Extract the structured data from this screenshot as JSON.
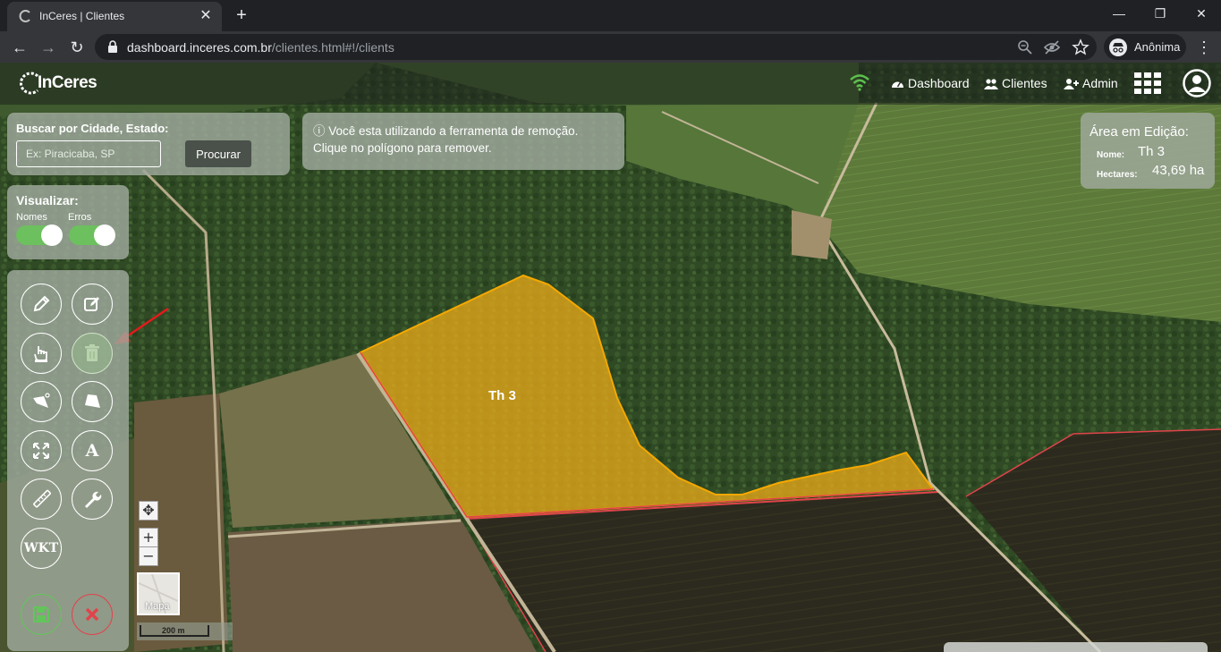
{
  "browser": {
    "tab_title": "InCeres | Clientes",
    "tab_close": "✕",
    "new_tab": "+",
    "window_controls": {
      "minimize": "—",
      "maximize": "❐",
      "close": "✕"
    },
    "nav": {
      "back": "←",
      "forward": "→",
      "reload": "↻"
    },
    "url_host": "dashboard.inceres.com.br",
    "url_path": "/clientes.html#!/clients",
    "profile_label": "Anônima",
    "menu": "⋮"
  },
  "app": {
    "logo_text": "InCeres",
    "nav_links": [
      {
        "label": "Dashboard",
        "icon": "gauge-icon"
      },
      {
        "label": "Clientes",
        "icon": "users-icon"
      },
      {
        "label": "Admin",
        "icon": "user-plus-icon"
      }
    ],
    "colors": {
      "accent_green": "#6cc05d",
      "polygon_fill": "#e6a81a",
      "polygon_stroke": "#f5a800",
      "removal_red": "#e0444b"
    }
  },
  "search": {
    "label": "Buscar por Cidade, Estado:",
    "placeholder": "Ex: Piracicaba, SP",
    "button": "Procurar"
  },
  "info": {
    "line1": "ⓘ Você esta utilizando a ferramenta de remoção.",
    "line2": "Clique no polígono para remover."
  },
  "edit_area": {
    "title": "Área em Edição:",
    "name_label": "Nome:",
    "name_value": "Th 3",
    "hectares_label": "Hectares:",
    "hectares_value": "43,69 ha"
  },
  "view": {
    "title": "Visualizar:",
    "toggles": [
      {
        "label": "Nomes",
        "on": true
      },
      {
        "label": "Erros",
        "on": true
      }
    ]
  },
  "tools": {
    "text_tool": "A",
    "wkt": "WKT",
    "items": [
      "pencil-icon",
      "edit-square-icon",
      "hand-pointer-icon",
      "trash-icon",
      "polygon-cut-icon",
      "polygon-shape-icon",
      "expand-icon",
      "text-a-icon",
      "ruler-icon",
      "wrench-icon",
      "wkt-icon",
      "save-icon",
      "cancel-icon"
    ]
  },
  "map": {
    "polygon_label": "Th 3",
    "zoom_in": "+",
    "zoom_out": "−",
    "pan": "✥",
    "basemap_label": "Mapa",
    "scale_label": "200 m"
  }
}
